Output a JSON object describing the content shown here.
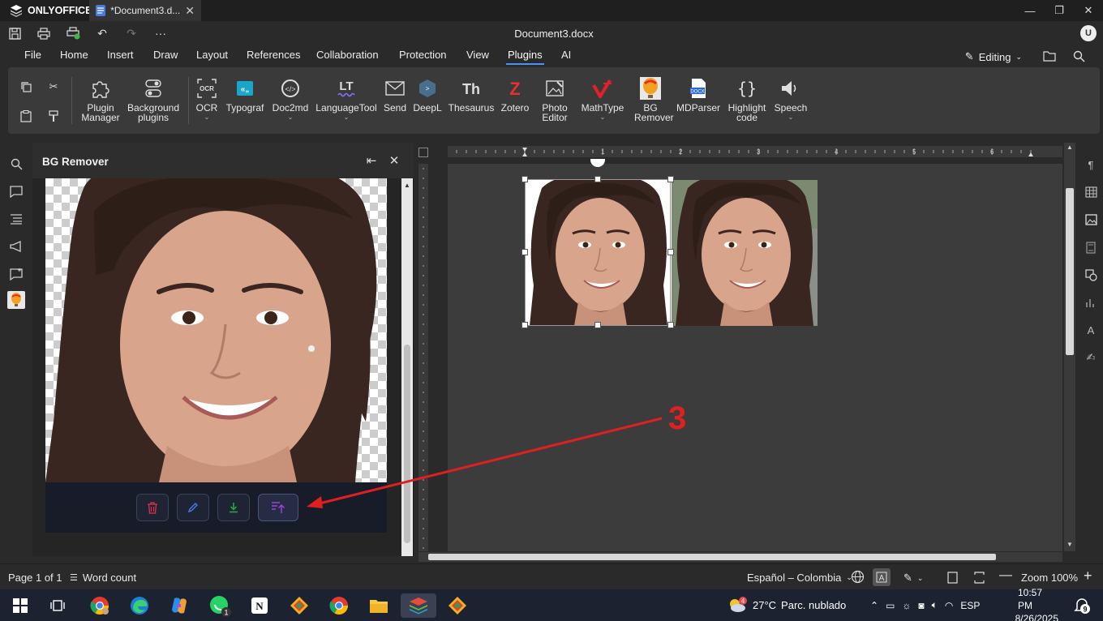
{
  "app": {
    "brand": "ONLYOFFICE",
    "tab_title": "*Document3.d...",
    "doc_title": "Document3.docx",
    "avatar_initial": "U"
  },
  "menu": [
    "File",
    "Home",
    "Insert",
    "Draw",
    "Layout",
    "References",
    "Collaboration",
    "Protection",
    "View",
    "Plugins",
    "AI"
  ],
  "menu_active": "Plugins",
  "editing_label": "Editing",
  "ribbon": {
    "plugin_manager": "Plugin Manager",
    "background_plugins": "Background plugins",
    "ocr": "OCR",
    "typograf": "Typograf",
    "doc2md": "Doc2md",
    "languagetool": "LanguageTool",
    "send": "Send",
    "deepl": "DeepL",
    "thesaurus": "Thesaurus",
    "zotero": "Zotero",
    "photo_editor": "Photo Editor",
    "mathtype": "MathType",
    "bg_remover": "BG Remover",
    "mdparser": "MDParser",
    "highlight_code": "Highlight code",
    "speech": "Speech"
  },
  "panel": {
    "title": "BG Remover"
  },
  "annotation": {
    "number": "3"
  },
  "status": {
    "page": "Page 1 of 1",
    "word_count": "Word count",
    "language": "Español – Colombia",
    "zoom": "Zoom 100%"
  },
  "taskbar": {
    "weather_temp": "27°C",
    "weather_desc": "Parc. nublado",
    "lang": "ESP",
    "time": "10:57 PM",
    "date": "8/26/2025",
    "notif_count": "9",
    "weather_badge": "4",
    "whatsapp_badge": "1"
  },
  "colors": {
    "accent": "#4a90ff",
    "annotation_red": "#e02020",
    "delete_icon": "#e0304a",
    "edit_icon": "#4a7ae8",
    "download_icon": "#2ea84a",
    "insert_icon": "#a040e0"
  }
}
